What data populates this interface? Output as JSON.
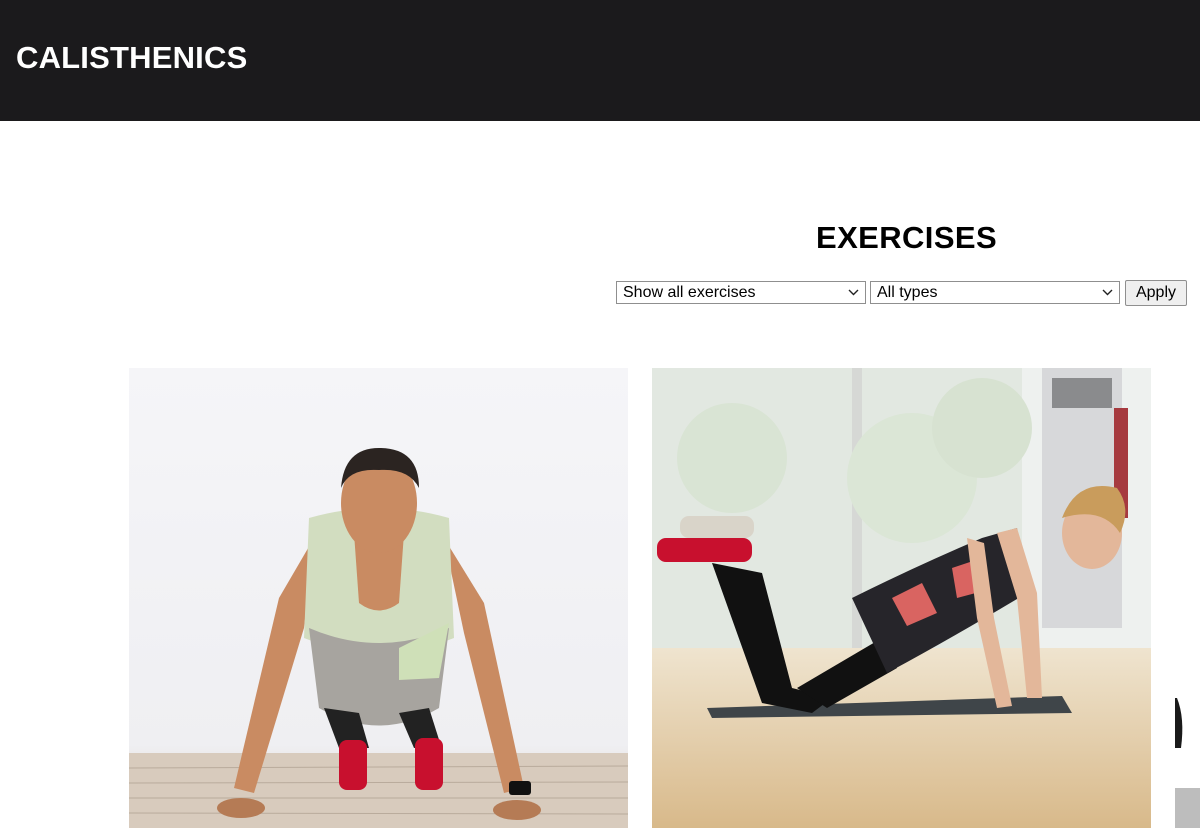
{
  "header": {
    "brand": "CALISTHENICS"
  },
  "main": {
    "title": "EXERCISES",
    "filters": {
      "exercise_select": {
        "selected": "Show all exercises"
      },
      "type_select": {
        "selected": "All types"
      },
      "apply_label": "Apply"
    },
    "exercises": [
      {
        "image": "man-doing-push-up-photo"
      },
      {
        "image": "woman-doing-knee-push-up-photo"
      },
      {
        "image": "partially-visible-exercise-photo"
      }
    ]
  },
  "colors": {
    "header_bg": "#1b1a1c",
    "header_text": "#ffffff",
    "page_bg": "#ffffff"
  }
}
